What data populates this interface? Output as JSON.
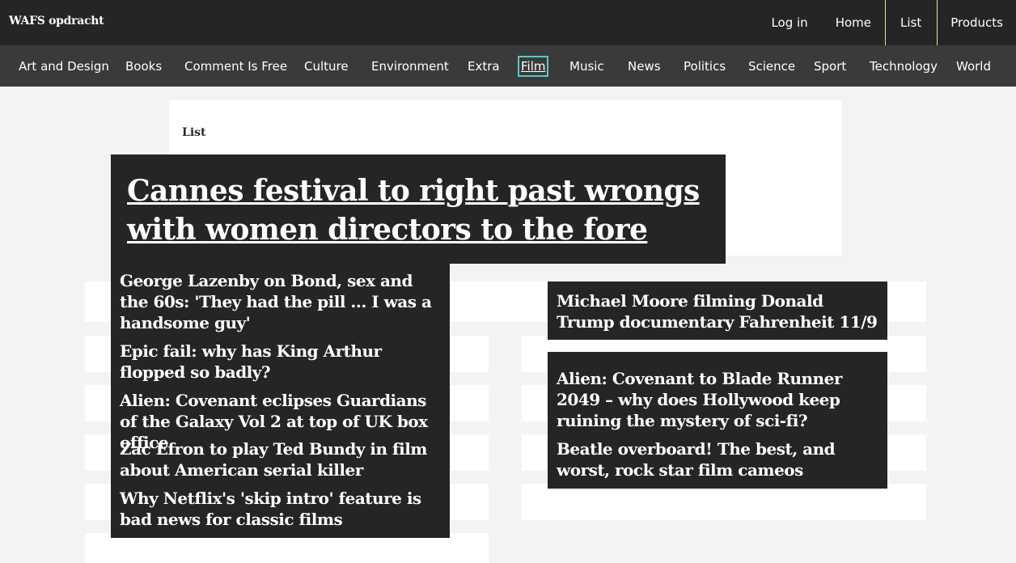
{
  "brand": "WAFS opdracht",
  "topnav": {
    "login": "Log in",
    "home": "Home",
    "list": "List",
    "products": "Products"
  },
  "categories": [
    "Art and Design",
    "Books",
    "Comment Is Free",
    "Culture",
    "Environment",
    "Extra",
    "Film",
    "Music",
    "News",
    "Politics",
    "Science",
    "Sport",
    "Technology",
    "World"
  ],
  "active_category": "Film",
  "list_label": "List",
  "featured_headline": "Cannes festival to right past wrongs with women directors to the fore",
  "left_articles": [
    "George Lazenby on Bond, sex and the 60s: 'They had the pill ... I was a handsome guy'",
    "Epic fail: why has King Arthur flopped so badly?",
    "Alien: Covenant eclipses Guardians of the Galaxy Vol 2 at top of UK box office",
    "Zac Efron to play Ted Bundy in film about American serial killer",
    "Why Netflix's 'skip intro' feature is bad news for classic films"
  ],
  "right_articles": [
    "Michael Moore filming Donald Trump documentary Fahrenheit 11/9",
    "Alien: Covenant to Blade Runner 2049 – why does Hollywood keep ruining the mystery of sci-fi?",
    "Beatle overboard! The best, and worst, rock star film cameos"
  ]
}
